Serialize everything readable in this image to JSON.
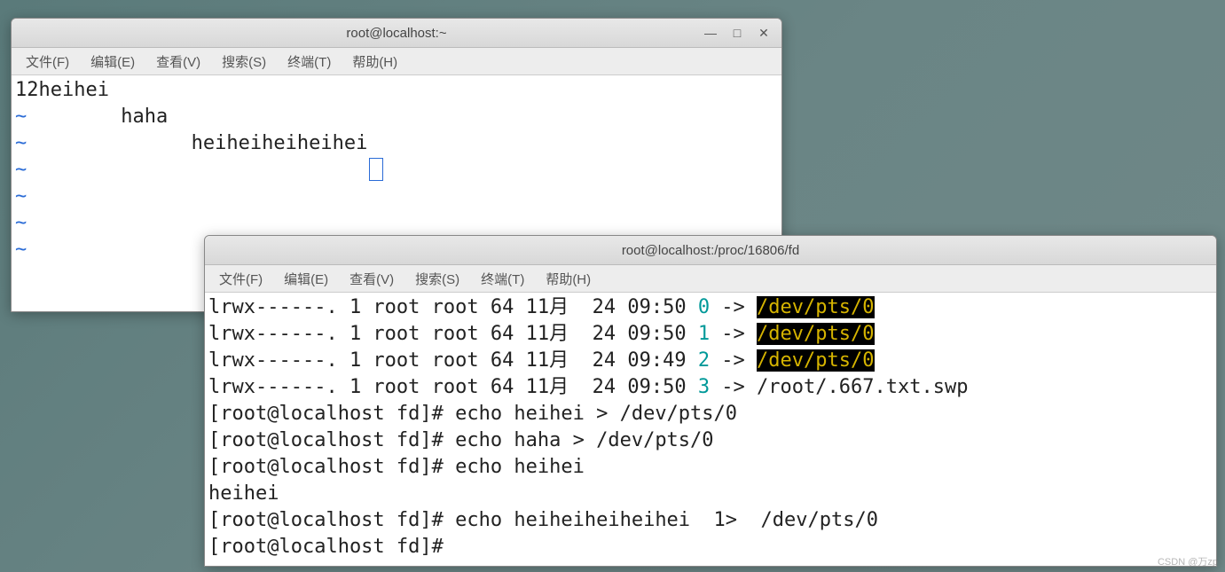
{
  "window1": {
    "title": "root@localhost:~",
    "menu": [
      "文件(F)",
      "编辑(E)",
      "查看(V)",
      "搜索(S)",
      "终端(T)",
      "帮助(H)"
    ],
    "lines": {
      "l1": "12heihei",
      "l2_tilde": "~",
      "l2_text": "        haha",
      "l3_tilde": "~",
      "l3_text": "              heiheiheiheihei",
      "l4_tilde": "~",
      "l5_tilde": "~",
      "l6_tilde": "~",
      "l7_tilde": "~"
    }
  },
  "window2": {
    "title": "root@localhost:/proc/16806/fd",
    "menu": [
      "文件(F)",
      "编辑(E)",
      "查看(V)",
      "搜索(S)",
      "终端(T)",
      "帮助(H)"
    ],
    "ls": [
      {
        "pre": "lrwx------. 1 root root 64 11月  24 09:50 ",
        "fd": "0",
        "arrow": " -> ",
        "target": "/dev/pts/0",
        "hl": true
      },
      {
        "pre": "lrwx------. 1 root root 64 11月  24 09:50 ",
        "fd": "1",
        "arrow": " -> ",
        "target": "/dev/pts/0",
        "hl": true
      },
      {
        "pre": "lrwx------. 1 root root 64 11月  24 09:49 ",
        "fd": "2",
        "arrow": " -> ",
        "target": "/dev/pts/0",
        "hl": true
      },
      {
        "pre": "lrwx------. 1 root root 64 11月  24 09:50 ",
        "fd": "3",
        "arrow": " -> ",
        "target": "/root/.667.txt.swp",
        "hl": false
      }
    ],
    "prompts": {
      "p1": "[root@localhost fd]# echo heihei > /dev/pts/0",
      "p2": "[root@localhost fd]# echo haha > /dev/pts/0",
      "p3": "[root@localhost fd]# echo heihei",
      "p3_out": "heihei",
      "p4": "[root@localhost fd]# echo heiheiheiheihei  1>  /dev/pts/0",
      "p5": "[root@localhost fd]# "
    }
  },
  "watermark": "CSDN @万zp"
}
